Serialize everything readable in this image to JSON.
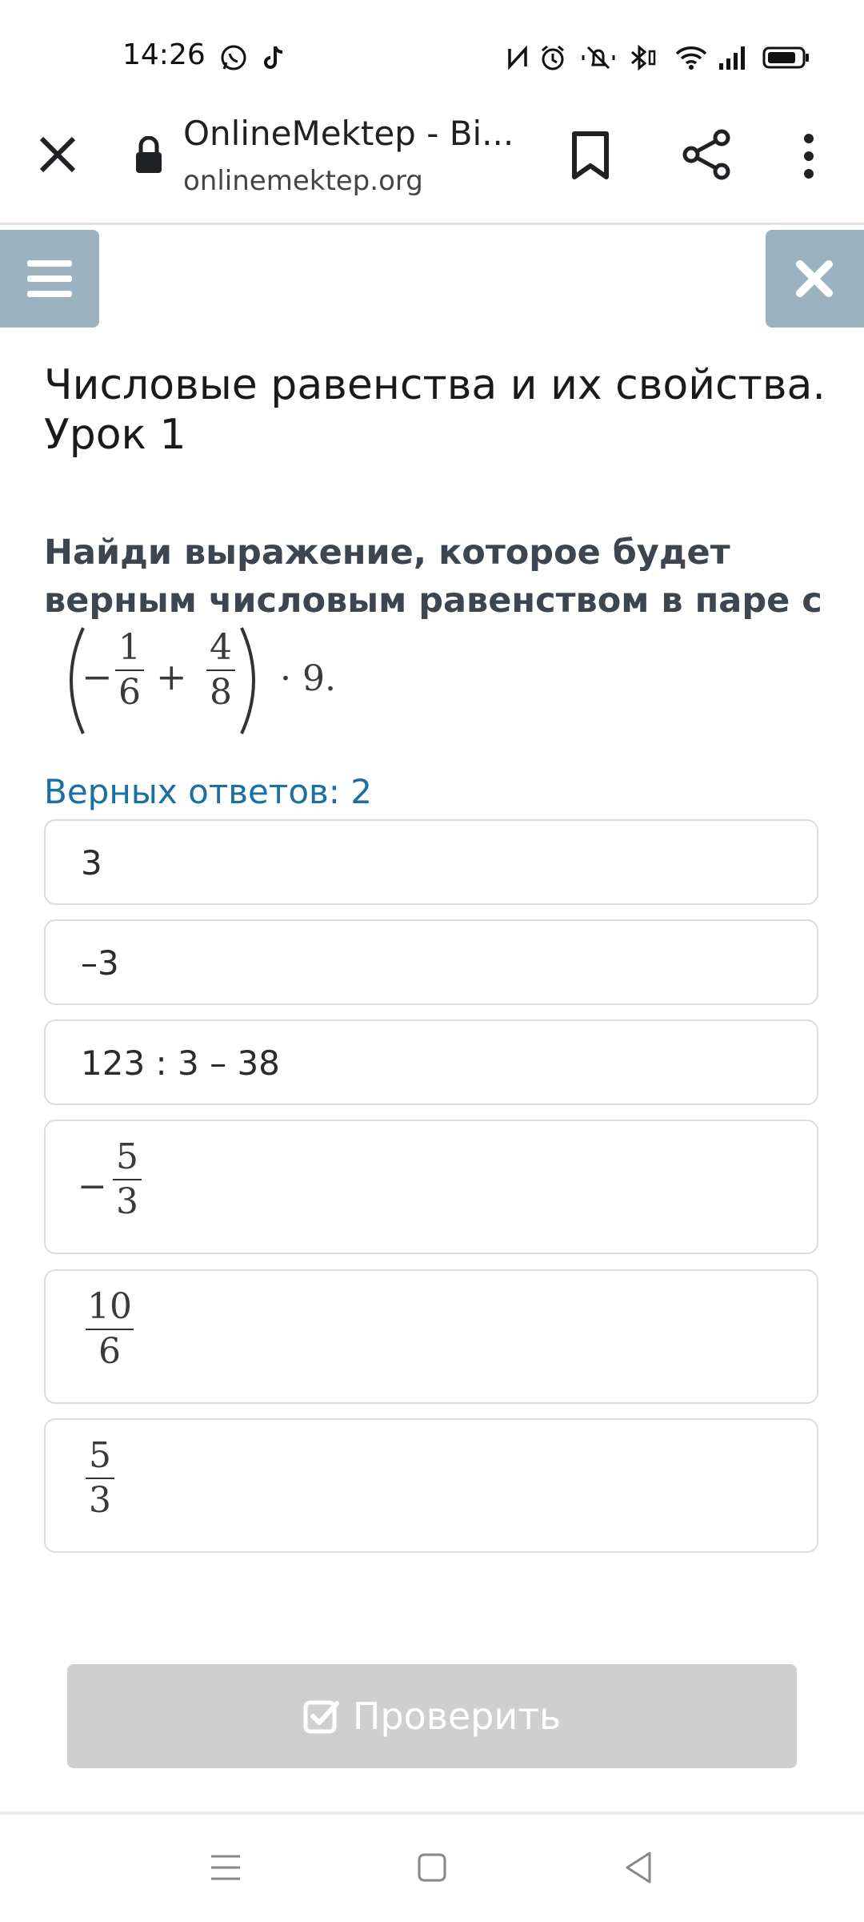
{
  "status_bar": {
    "time": "14:26",
    "icons": [
      "whatsapp-icon",
      "tiktok-icon",
      "nfc-icon",
      "alarm-icon",
      "mute-icon",
      "bluetooth-icon",
      "wifi-icon",
      "signal-icon",
      "battery-icon"
    ]
  },
  "browser": {
    "title": "OnlineMektep - Bi...",
    "url": "onlinemektep.org"
  },
  "lesson": {
    "title": "Числовые равенства и их свойства. Урок 1"
  },
  "question": {
    "text": "Найди выражение, которое будет верным числовым равенством в паре с",
    "expression": {
      "frac1_num": "1",
      "frac1_den": "6",
      "frac2_num": "4",
      "frac2_den": "8",
      "minus": "−",
      "plus": "+",
      "tail": "· 9."
    }
  },
  "answers_count": "Верных ответов: 2",
  "options": [
    {
      "text": "3"
    },
    {
      "text": "–3"
    },
    {
      "text": "123 : 3 – 38"
    },
    {
      "sign": "−",
      "num": "5",
      "den": "3"
    },
    {
      "num": "10",
      "den": "6"
    },
    {
      "num": "5",
      "den": "3"
    }
  ],
  "check_button": {
    "label": "Проверить"
  },
  "colors": {
    "side_buttons": "#9bb2c1",
    "answers_count": "#1a6fa3",
    "check_button_disabled": "#cfcfcf"
  }
}
